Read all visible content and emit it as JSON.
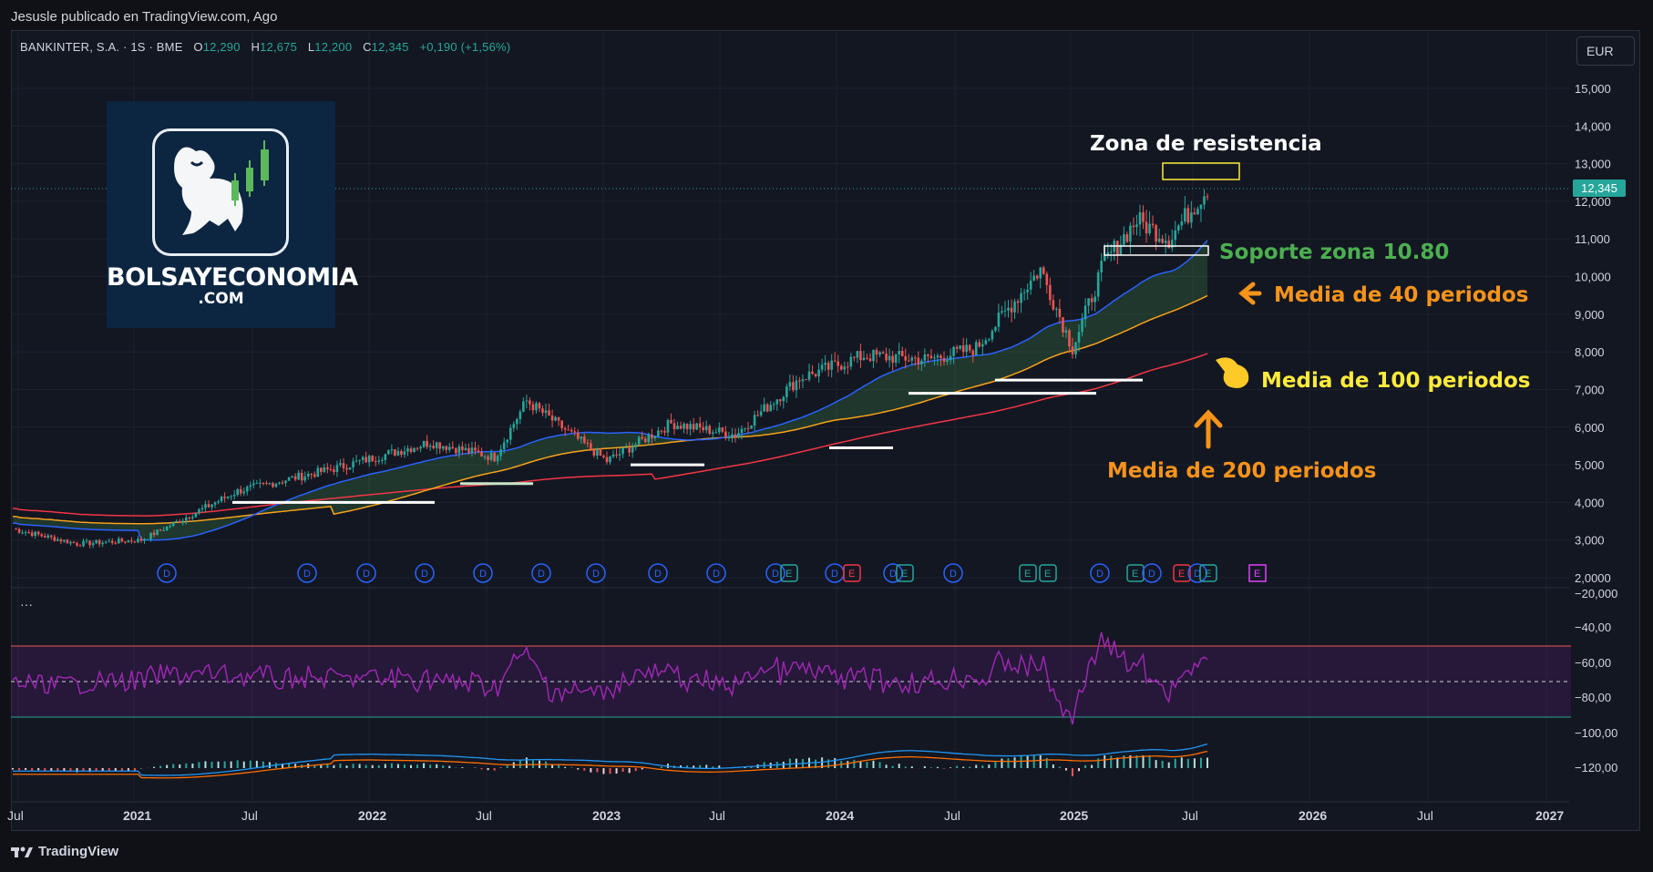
{
  "caption": "Jesusle publicado en TradingView.com, Ago",
  "legend": {
    "symbol": "BANKINTER, S.A. · 1S · BME",
    "open_label": "O",
    "open": "12,290",
    "high_label": "H",
    "high": "12,675",
    "low_label": "L",
    "low": "12,200",
    "close_label": "C",
    "close": "12,345",
    "change": "+0,190 (+1,56%)"
  },
  "currency": "EUR",
  "last_price": "12,345",
  "logo": {
    "name": "BOLSAYECONOMIA",
    "domain": ".COM",
    "icon": "bull-candlestick-icon"
  },
  "annotations": {
    "resistance": "Zona de resistencia",
    "support": "Soporte zona 10.80",
    "ma40": "Media de 40 periodos",
    "ma100": "Media de 100 periodos",
    "ma200": "Media de 200 periodos"
  },
  "price_axis": [
    "15,000",
    "14,000",
    "13,000",
    "12,000",
    "11,000",
    "10,000",
    "9,000",
    "8,000",
    "7,000",
    "6,000",
    "5,000",
    "4,000",
    "3,000",
    "2,0000"
  ],
  "osc_axis": [
    "−20,000",
    "−40,00",
    "−60,00",
    "−80,00",
    "−100,00",
    "−120,00"
  ],
  "time_axis": [
    {
      "label": "Jul",
      "year": false
    },
    {
      "label": "2021",
      "year": true
    },
    {
      "label": "Jul",
      "year": false
    },
    {
      "label": "2022",
      "year": true
    },
    {
      "label": "Jul",
      "year": false
    },
    {
      "label": "2023",
      "year": true
    },
    {
      "label": "Jul",
      "year": false
    },
    {
      "label": "2024",
      "year": true
    },
    {
      "label": "Jul",
      "year": false
    },
    {
      "label": "2025",
      "year": true
    },
    {
      "label": "Jul",
      "year": false
    },
    {
      "label": "2026",
      "year": true
    },
    {
      "label": "Jul",
      "year": false
    },
    {
      "label": "2027",
      "year": true
    }
  ],
  "events": [
    "D",
    "D",
    "D",
    "D",
    "D",
    "D",
    "D",
    "D",
    "D",
    "D",
    "E",
    "D",
    "E",
    "D",
    "E",
    "D",
    "E",
    "E",
    "D",
    "E",
    "D",
    "E",
    "D",
    "E",
    "E"
  ],
  "ellipsis": "···",
  "footer": "TradingView",
  "colors": {
    "up": "#26a69a",
    "down": "#ef5350",
    "ma40": "#2962ff",
    "ma100": "#f7a21b",
    "ma200": "#f23645",
    "rsi": "#9c27b0",
    "annotation_orange": "#f7931a",
    "annotation_green": "#4caf50",
    "annotation_yellow": "#ffeb3b"
  }
}
